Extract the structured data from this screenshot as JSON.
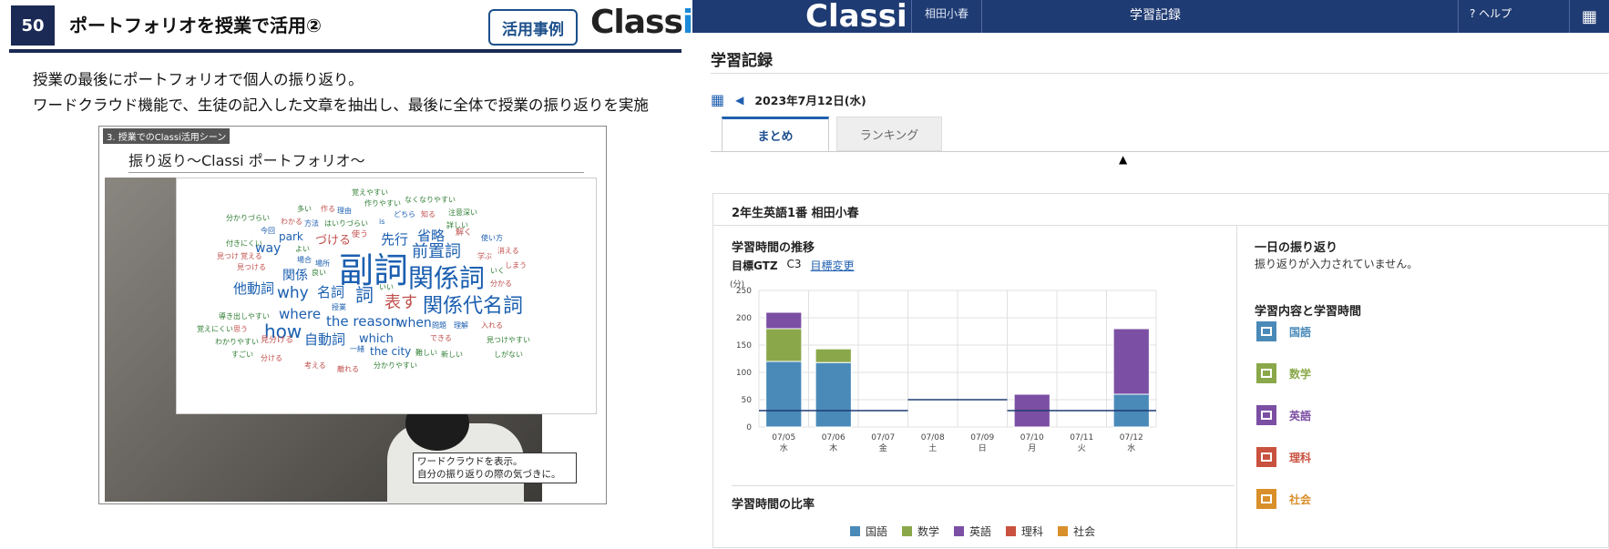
{
  "slide": {
    "number": "50",
    "title": "ポートフォリオを授業で活用②",
    "case_label": "活用事例",
    "logo": "Classi",
    "lines": [
      "授業の最後にポートフォリオで個人の振り返り。",
      "ワードクラウド機能で、生徒の記入した文章を抽出し、最後に全体で授業の振り返りを実施"
    ],
    "frame_tag": "3. 授業でのClassi活用シーン",
    "frame_title": "振り返り〜Classi ポートフォリオ〜",
    "caption_lines": [
      "ワードクラウドを表示。",
      "自分の振り返りの際の気づきに。"
    ],
    "word_cloud": [
      {
        "text": "副詞",
        "size": 38,
        "color": "#1b5fb0"
      },
      {
        "text": "関係詞",
        "size": 28,
        "color": "#1b5fb0"
      },
      {
        "text": "関係代名詞",
        "size": 22,
        "color": "#1b5fb0"
      },
      {
        "text": "表す",
        "size": 18,
        "color": "#c0504d"
      },
      {
        "text": "詞",
        "size": 20,
        "color": "#1b5fb0"
      },
      {
        "text": "前置詞",
        "size": 18,
        "color": "#1b5fb0"
      },
      {
        "text": "省略",
        "size": 15,
        "color": "#1b5fb0"
      },
      {
        "text": "先行",
        "size": 15,
        "color": "#1b5fb0"
      },
      {
        "text": "づける",
        "size": 13,
        "color": "#c0504d"
      },
      {
        "text": "why",
        "size": 17,
        "color": "#1b5fb0"
      },
      {
        "text": "名詞",
        "size": 15,
        "color": "#1b5fb0"
      },
      {
        "text": "他動詞",
        "size": 15,
        "color": "#1b5fb0"
      },
      {
        "text": "関係",
        "size": 14,
        "color": "#1b5fb0"
      },
      {
        "text": "way",
        "size": 14,
        "color": "#1b5fb0"
      },
      {
        "text": "park",
        "size": 12,
        "color": "#1b5fb0"
      },
      {
        "text": "where",
        "size": 15,
        "color": "#1b5fb0"
      },
      {
        "text": "how",
        "size": 20,
        "color": "#1b5fb0"
      },
      {
        "text": "the reason",
        "size": 15,
        "color": "#1b5fb0"
      },
      {
        "text": "when",
        "size": 14,
        "color": "#1b5fb0"
      },
      {
        "text": "自動詞",
        "size": 15,
        "color": "#1b5fb0"
      },
      {
        "text": "which",
        "size": 13,
        "color": "#1b5fb0"
      },
      {
        "text": "the city",
        "size": 12,
        "color": "#1b5fb0"
      },
      {
        "text": "覚えやすい",
        "size": 8,
        "color": "#2e7d32"
      },
      {
        "text": "なくなりやすい",
        "size": 8,
        "color": "#2e7d32"
      },
      {
        "text": "分かりづらい",
        "size": 8,
        "color": "#2e7d32"
      },
      {
        "text": "注意深い",
        "size": 8,
        "color": "#2e7d32"
      },
      {
        "text": "使い方",
        "size": 8,
        "color": "#1b5fb0"
      },
      {
        "text": "解く",
        "size": 9,
        "color": "#c0504d"
      },
      {
        "text": "消える",
        "size": 8,
        "color": "#c0504d"
      },
      {
        "text": "学ぶ",
        "size": 8,
        "color": "#c0504d"
      },
      {
        "text": "しまう",
        "size": 8,
        "color": "#c0504d"
      },
      {
        "text": "いく",
        "size": 8,
        "color": "#2e7d32"
      },
      {
        "text": "分かる",
        "size": 8,
        "color": "#c0504d"
      },
      {
        "text": "見つけやすい",
        "size": 8,
        "color": "#2e7d32"
      },
      {
        "text": "しがない",
        "size": 8,
        "color": "#2e7d32"
      },
      {
        "text": "新しい",
        "size": 8,
        "color": "#2e7d32"
      },
      {
        "text": "分かりやすい",
        "size": 8,
        "color": "#2e7d32"
      },
      {
        "text": "離れる",
        "size": 8,
        "color": "#c0504d"
      },
      {
        "text": "考える",
        "size": 8,
        "color": "#c0504d"
      },
      {
        "text": "分ける",
        "size": 8,
        "color": "#c0504d"
      },
      {
        "text": "すごい",
        "size": 8,
        "color": "#2e7d32"
      },
      {
        "text": "わかりやすい",
        "size": 8,
        "color": "#2e7d32"
      },
      {
        "text": "覚えにくい",
        "size": 8,
        "color": "#2e7d32"
      },
      {
        "text": "導き出しやすい",
        "size": 8,
        "color": "#2e7d32"
      },
      {
        "text": "見つける",
        "size": 8,
        "color": "#c0504d"
      },
      {
        "text": "覚える",
        "size": 8,
        "color": "#c0504d"
      },
      {
        "text": "付きにくい",
        "size": 8,
        "color": "#2e7d32"
      },
      {
        "text": "今回",
        "size": 8,
        "color": "#1b5fb0"
      },
      {
        "text": "わかる",
        "size": 8,
        "color": "#c0504d"
      },
      {
        "text": "多い",
        "size": 8,
        "color": "#2e7d32"
      },
      {
        "text": "作る",
        "size": 8,
        "color": "#c0504d"
      },
      {
        "text": "理由",
        "size": 8,
        "color": "#1b5fb0"
      },
      {
        "text": "方法",
        "size": 8,
        "color": "#1b5fb0"
      },
      {
        "text": "はいりづらい",
        "size": 8,
        "color": "#2e7d32"
      },
      {
        "text": "使う",
        "size": 9,
        "color": "#c0504d"
      },
      {
        "text": "場合",
        "size": 8,
        "color": "#1b5fb0"
      },
      {
        "text": "場所",
        "size": 8,
        "color": "#1b5fb0"
      },
      {
        "text": "良い",
        "size": 8,
        "color": "#2e7d32"
      },
      {
        "text": "授業",
        "size": 8,
        "color": "#1b5fb0"
      },
      {
        "text": "問題",
        "size": 8,
        "color": "#1b5fb0"
      },
      {
        "text": "理解",
        "size": 8,
        "color": "#1b5fb0"
      },
      {
        "text": "入れる",
        "size": 8,
        "color": "#c0504d"
      },
      {
        "text": "できる",
        "size": 8,
        "color": "#c0504d"
      },
      {
        "text": "難しい",
        "size": 8,
        "color": "#2e7d32"
      },
      {
        "text": "一緒",
        "size": 8,
        "color": "#1b5fb0"
      },
      {
        "text": "思う",
        "size": 8,
        "color": "#c0504d"
      },
      {
        "text": "見分ける",
        "size": 9,
        "color": "#c0504d"
      },
      {
        "text": "作りやすい",
        "size": 8,
        "color": "#2e7d32"
      },
      {
        "text": "どちら",
        "size": 8,
        "color": "#1b5fb0"
      },
      {
        "text": "知る",
        "size": 8,
        "color": "#c0504d"
      },
      {
        "text": "詳しい",
        "size": 8,
        "color": "#2e7d32"
      },
      {
        "text": "is",
        "size": 8,
        "color": "#1b5fb0"
      },
      {
        "text": "よい",
        "size": 8,
        "color": "#2e7d32"
      },
      {
        "text": "いい",
        "size": 8,
        "color": "#2e7d32"
      },
      {
        "text": "見つけ",
        "size": 8,
        "color": "#c0504d"
      }
    ]
  },
  "app": {
    "logo": "Classi",
    "user": "相田小春",
    "header_title": "学習記録",
    "help": "? ヘルプ",
    "page_heading": "学習記録",
    "date": "2023年7月12日(水)",
    "tabs": [
      "まとめ",
      "ランキング"
    ],
    "student": "2年生英語1番 相田小春",
    "section_trend": "学習時間の推移",
    "goal_label": "目標GTZ",
    "goal_value": "C3",
    "goal_link": "目標変更",
    "section_ratio": "学習時間の比率",
    "section_daily": "一日の振り返り",
    "daily_empty": "振り返りが入力されていません。",
    "section_subjects": "学習内容と学習時間",
    "subjects": [
      {
        "name": "国語",
        "color": "#4a8ab8"
      },
      {
        "name": "数学",
        "color": "#8aa84a"
      },
      {
        "name": "英語",
        "color": "#7b4fa3"
      },
      {
        "name": "理科",
        "color": "#c9513f"
      },
      {
        "name": "社会",
        "color": "#d98f2a"
      }
    ]
  },
  "chart_data": {
    "type": "bar",
    "stacked": true,
    "unit": "(分)",
    "ylim": [
      0,
      250
    ],
    "yticks": [
      0,
      50,
      100,
      150,
      200,
      250
    ],
    "categories": [
      "07/05",
      "07/06",
      "07/07",
      "07/08",
      "07/09",
      "07/10",
      "07/11",
      "07/12"
    ],
    "weekdays": [
      "水",
      "木",
      "金",
      "土",
      "日",
      "月",
      "火",
      "水"
    ],
    "series": [
      {
        "name": "国語",
        "color": "#4a8ab8",
        "values": [
          120,
          118,
          0,
          0,
          0,
          0,
          0,
          60
        ]
      },
      {
        "name": "数学",
        "color": "#8aa84a",
        "values": [
          60,
          25,
          0,
          0,
          0,
          0,
          0,
          0
        ]
      },
      {
        "name": "英語",
        "color": "#7b4fa3",
        "values": [
          30,
          0,
          0,
          0,
          0,
          60,
          0,
          120
        ]
      },
      {
        "name": "理科",
        "color": "#c9513f",
        "values": [
          0,
          0,
          0,
          0,
          0,
          0,
          0,
          0
        ]
      },
      {
        "name": "社会",
        "color": "#d98f2a",
        "values": [
          0,
          0,
          0,
          0,
          0,
          0,
          0,
          0
        ]
      }
    ],
    "goal_line": [
      30,
      30,
      30,
      50,
      50,
      30,
      30,
      30
    ],
    "grid": true
  }
}
